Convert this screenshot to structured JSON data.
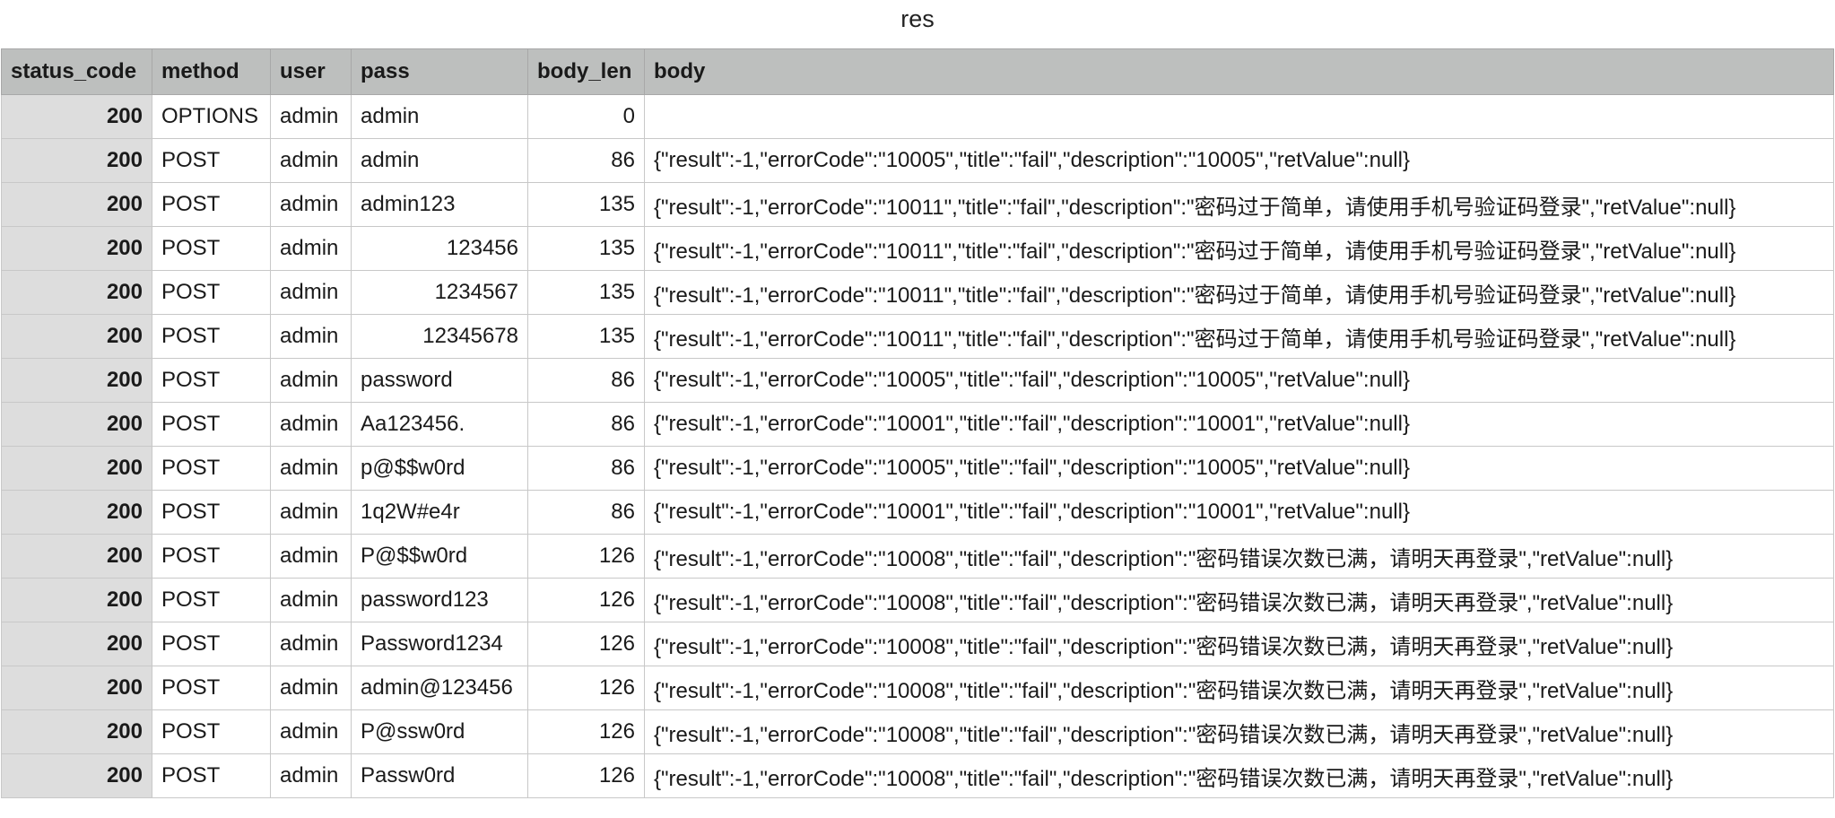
{
  "sheet": {
    "title": "res"
  },
  "table": {
    "columns": [
      "status_code",
      "method",
      "user",
      "pass",
      "body_len",
      "body"
    ],
    "rows": [
      {
        "status_code": "200",
        "method": "OPTIONS",
        "user": "admin",
        "pass": "admin",
        "pass_numeric": false,
        "body_len": "0",
        "body": ""
      },
      {
        "status_code": "200",
        "method": "POST",
        "user": "admin",
        "pass": "admin",
        "pass_numeric": false,
        "body_len": "86",
        "body": "{\"result\":-1,\"errorCode\":\"10005\",\"title\":\"fail\",\"description\":\"10005\",\"retValue\":null}"
      },
      {
        "status_code": "200",
        "method": "POST",
        "user": "admin",
        "pass": "admin123",
        "pass_numeric": false,
        "body_len": "135",
        "body": "{\"result\":-1,\"errorCode\":\"10011\",\"title\":\"fail\",\"description\":\"密码过于简单，请使用手机号验证码登录\",\"retValue\":null}"
      },
      {
        "status_code": "200",
        "method": "POST",
        "user": "admin",
        "pass": "123456",
        "pass_numeric": true,
        "body_len": "135",
        "body": "{\"result\":-1,\"errorCode\":\"10011\",\"title\":\"fail\",\"description\":\"密码过于简单，请使用手机号验证码登录\",\"retValue\":null}"
      },
      {
        "status_code": "200",
        "method": "POST",
        "user": "admin",
        "pass": "1234567",
        "pass_numeric": true,
        "body_len": "135",
        "body": "{\"result\":-1,\"errorCode\":\"10011\",\"title\":\"fail\",\"description\":\"密码过于简单，请使用手机号验证码登录\",\"retValue\":null}"
      },
      {
        "status_code": "200",
        "method": "POST",
        "user": "admin",
        "pass": "12345678",
        "pass_numeric": true,
        "body_len": "135",
        "body": "{\"result\":-1,\"errorCode\":\"10011\",\"title\":\"fail\",\"description\":\"密码过于简单，请使用手机号验证码登录\",\"retValue\":null}"
      },
      {
        "status_code": "200",
        "method": "POST",
        "user": "admin",
        "pass": "password",
        "pass_numeric": false,
        "body_len": "86",
        "body": "{\"result\":-1,\"errorCode\":\"10005\",\"title\":\"fail\",\"description\":\"10005\",\"retValue\":null}"
      },
      {
        "status_code": "200",
        "method": "POST",
        "user": "admin",
        "pass": "Aa123456.",
        "pass_numeric": false,
        "body_len": "86",
        "body": "{\"result\":-1,\"errorCode\":\"10001\",\"title\":\"fail\",\"description\":\"10001\",\"retValue\":null}"
      },
      {
        "status_code": "200",
        "method": "POST",
        "user": "admin",
        "pass": "p@$$w0rd",
        "pass_numeric": false,
        "body_len": "86",
        "body": "{\"result\":-1,\"errorCode\":\"10005\",\"title\":\"fail\",\"description\":\"10005\",\"retValue\":null}"
      },
      {
        "status_code": "200",
        "method": "POST",
        "user": "admin",
        "pass": "1q2W#e4r",
        "pass_numeric": false,
        "body_len": "86",
        "body": "{\"result\":-1,\"errorCode\":\"10001\",\"title\":\"fail\",\"description\":\"10001\",\"retValue\":null}"
      },
      {
        "status_code": "200",
        "method": "POST",
        "user": "admin",
        "pass": "P@$$w0rd",
        "pass_numeric": false,
        "body_len": "126",
        "body": "{\"result\":-1,\"errorCode\":\"10008\",\"title\":\"fail\",\"description\":\"密码错误次数已满，请明天再登录\",\"retValue\":null}"
      },
      {
        "status_code": "200",
        "method": "POST",
        "user": "admin",
        "pass": "password123",
        "pass_numeric": false,
        "body_len": "126",
        "body": "{\"result\":-1,\"errorCode\":\"10008\",\"title\":\"fail\",\"description\":\"密码错误次数已满，请明天再登录\",\"retValue\":null}"
      },
      {
        "status_code": "200",
        "method": "POST",
        "user": "admin",
        "pass": "Password1234",
        "pass_numeric": false,
        "body_len": "126",
        "body": "{\"result\":-1,\"errorCode\":\"10008\",\"title\":\"fail\",\"description\":\"密码错误次数已满，请明天再登录\",\"retValue\":null}"
      },
      {
        "status_code": "200",
        "method": "POST",
        "user": "admin",
        "pass": "admin@123456",
        "pass_numeric": false,
        "body_len": "126",
        "body": "{\"result\":-1,\"errorCode\":\"10008\",\"title\":\"fail\",\"description\":\"密码错误次数已满，请明天再登录\",\"retValue\":null}"
      },
      {
        "status_code": "200",
        "method": "POST",
        "user": "admin",
        "pass": "P@ssw0rd",
        "pass_numeric": false,
        "body_len": "126",
        "body": "{\"result\":-1,\"errorCode\":\"10008\",\"title\":\"fail\",\"description\":\"密码错误次数已满，请明天再登录\",\"retValue\":null}"
      },
      {
        "status_code": "200",
        "method": "POST",
        "user": "admin",
        "pass": "Passw0rd",
        "pass_numeric": false,
        "body_len": "126",
        "body": "{\"result\":-1,\"errorCode\":\"10008\",\"title\":\"fail\",\"description\":\"密码错误次数已满，请明天再登录\",\"retValue\":null}"
      }
    ]
  },
  "colors": {
    "header_bg": "#bdbfbe",
    "status_col_bg": "#dddddd",
    "grid_line": "#c8c8c8"
  }
}
